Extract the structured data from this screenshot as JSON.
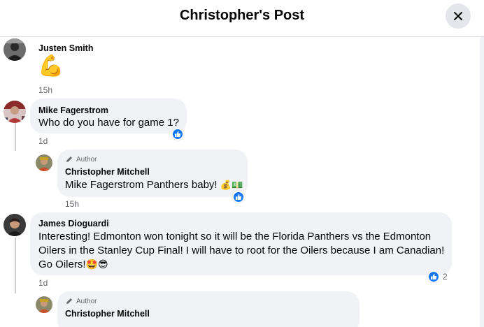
{
  "header": {
    "title": "Christopher's Post"
  },
  "comments": [
    {
      "name": "Justen Smith",
      "emoji": "💪",
      "time": "15h"
    },
    {
      "name": "Mike Fagerstrom",
      "text": "Who do you have for game 1?",
      "time": "1d",
      "reply": {
        "badge": "Author",
        "name": "Christopher Mitchell",
        "text": "Mike Fagerstrom Panthers baby!",
        "emojis": "💰💵",
        "time": "15h"
      }
    },
    {
      "name": "James Dioguardi",
      "lines": [
        "Interesting! Edmonton won tonight so it will be the Florida Panthers vs the Edmonton",
        "Oilers in the Stanley Cup Final! I will have to root for the Oilers because I am Canadian!",
        "Go Oilers!"
      ],
      "trail_emojis": "🤩😎",
      "reaction_count": "2",
      "time": "1d",
      "reply": {
        "badge": "Author",
        "name": "Christopher Mitchell"
      }
    }
  ]
}
